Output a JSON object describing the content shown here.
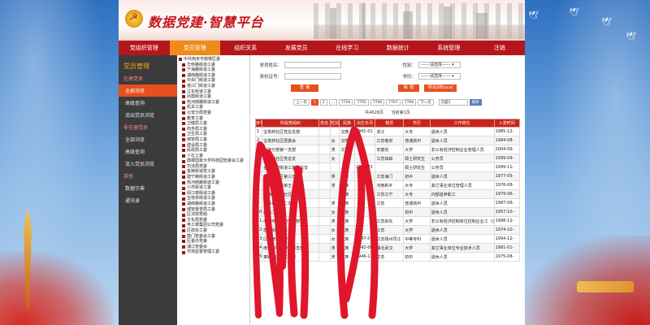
{
  "site_title": "数据党建·智慧平台",
  "nav": [
    "党组织管理",
    "党员管理",
    "组织关系",
    "发展党员",
    "在线学习",
    "数据统计",
    "系统管理",
    "注销"
  ],
  "nav_active": 1,
  "sidebar": {
    "title": "党员管理",
    "groups": [
      {
        "name": "在册党员",
        "items": [
          "全部浏览",
          "高级查询",
          "流出党员浏览"
        ]
      },
      {
        "name": "非在册党员",
        "items": [
          "全部浏览",
          "高级查询",
          "流入党员浏览"
        ]
      },
      {
        "name": "其他",
        "items": [
          "数据字典",
          "通讯录"
        ]
      }
    ]
  },
  "tree": {
    "root": "中共南京市鼓楼区委",
    "children": [
      "华侨路街道工委",
      "宁海路街道工委",
      "湖南路街道工委",
      "中央门街道工委",
      "挹江门街道工委",
      "江东街道工委",
      "凤凰街道工委",
      "热河南路街道工委",
      "机关工委",
      "公安分局党委",
      "教育工委",
      "卫健局工委",
      "商务局工委",
      "卫生局工委",
      "城管局工委",
      "建设局工委",
      "民政局工委",
      "人社工委",
      "鼓楼国家大学科技园管委会工委",
      "司法局党委",
      "金陵街道党工委",
      "建宁路街道工委",
      "热河南路街道工委",
      "小市街道工委",
      "阅江楼街道工委",
      "宝塔桥街道工委",
      "湖南路街道工委",
      "城管督查局工委",
      "区法院党组",
      "文化局党委",
      "电工楼集团公司党委",
      "区政协工委",
      "鼓门管委会工委",
      "区委办党委",
      "浦江管委会",
      "市场监督管理工委"
    ]
  },
  "form": {
    "name_label": "党员姓名：",
    "id_label": "身份证号：",
    "gender_label": "性别：",
    "edu_label": "学历：",
    "select_placeholder": "------请选择------",
    "search_btn": "查 询",
    "add_btn": "新 增",
    "export_btn": "导出到Excel"
  },
  "pager": {
    "items": [
      "上一页",
      "1",
      "2",
      "...",
      "7704",
      "7705",
      "7706",
      "7707",
      "7708",
      "下一页"
    ],
    "current": "1",
    "goto_value": "页面1",
    "goto_btn": "跳转",
    "total": "共4628页",
    "current_text": "当前第1页"
  },
  "table": {
    "headers": [
      "序号",
      "所属党组织",
      "姓名",
      "性别",
      "民族",
      "出生年月",
      "籍贯",
      "学历",
      "工作岗位",
      "入党时间"
    ],
    "rows": [
      [
        "1",
        "宝塔桥社区党总支部",
        "",
        "",
        "汉族",
        "1941-01",
        "浙江",
        "大专",
        "退休人员",
        "1985-12-"
      ],
      [
        "2",
        "宝塔桥社区居委会",
        "",
        "女",
        "汉族",
        "",
        "江苏南京",
        "普通高中",
        "退休人员",
        "1984-08-"
      ],
      [
        "3",
        "金陵分部第一支部",
        "",
        "男",
        "汉族",
        "",
        "安徽省",
        "大学",
        "非公有经济控制企业管理人员",
        "2004-06-"
      ],
      [
        "4",
        "宝塔桥社区党总支",
        "",
        "女",
        "",
        "",
        "江苏如皋",
        "硕士研究生",
        "公务员",
        "1999-09-"
      ],
      [
        "5",
        "金陵分部街道工委党总支",
        "",
        "",
        "",
        "1972-03",
        "",
        "硕士研究生",
        "公务员",
        "1999-11-"
      ],
      [
        "6",
        "宝塔桥社区第三支部",
        "",
        "男",
        "汉族",
        "",
        "江苏海门",
        "初中",
        "退休人员",
        "1977-05-"
      ],
      [
        "7",
        "热河路街道第五支部",
        "",
        "男",
        "汉族",
        "",
        "河南新乡",
        "大专",
        "其它事业单位管理人员",
        "1976-08-"
      ],
      [
        "8",
        "山西路街道社区支部",
        "",
        "",
        "汉族",
        "",
        "江苏江宁",
        "大专",
        "内部退养职工",
        "1979-06-"
      ],
      [
        "9",
        "宝苏社区第二支部",
        "",
        "男",
        "汉族",
        "",
        "江苏",
        "普通高中",
        "退休人员",
        "1987-06-"
      ],
      [
        "10",
        "西路二支部",
        "",
        "女",
        "汉族",
        "",
        "",
        "初中",
        "退休人员",
        "1957-10-"
      ],
      [
        "11",
        "南京电力公司党支部",
        "",
        "男",
        "汉族",
        "",
        "江苏启东",
        "大学",
        "非公有经济控制单位控制企业工（含",
        "1998-12-"
      ],
      [
        "12",
        "鼓楼街社区二支部",
        "",
        "女",
        "汉族",
        "",
        "江苏",
        "大学",
        "退休人员",
        "1974-10-"
      ],
      [
        "13",
        "区三牌楼小学",
        "",
        "女",
        "汉族",
        "1947-03",
        "江苏扬州邗江",
        "中等专科",
        "退休人员",
        "1994-12-"
      ],
      [
        "14",
        "南大附中高中理科支部",
        "",
        "男",
        "汉族",
        "1942-08",
        "湖北武汉",
        "大学",
        "其它事业单位专业技术人员",
        "1981-01-"
      ],
      [
        "15",
        "察路社区第二支部",
        "",
        "男",
        "汉族",
        "1946-11",
        "江苏",
        "初中",
        "退休人员",
        "1975-08-"
      ]
    ]
  },
  "colors": {
    "brand_red": "#b5161b",
    "accent_orange": "#e5501e",
    "nav_active": "#f08a18",
    "scribble": "#e0162b"
  }
}
